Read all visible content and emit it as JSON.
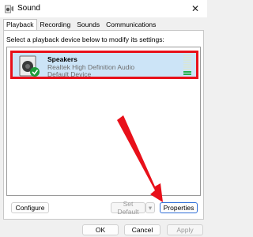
{
  "window": {
    "title": "Sound",
    "close_glyph": "✕"
  },
  "tabs": [
    {
      "label": "Playback",
      "active": true
    },
    {
      "label": "Recording",
      "active": false
    },
    {
      "label": "Sounds",
      "active": false
    },
    {
      "label": "Communications",
      "active": false
    }
  ],
  "instructions": "Select a playback device below to modify its settings:",
  "devices": [
    {
      "name": "Speakers",
      "description": "Realtek High Definition Audio",
      "status": "Default Device",
      "icon": "speaker-icon",
      "badge_icon": "default-check-icon",
      "level": 0.2
    }
  ],
  "buttons": {
    "configure": "Configure",
    "set_default": "Set Default",
    "set_default_arrow": "▾",
    "properties": "Properties",
    "ok": "OK",
    "cancel": "Cancel",
    "apply": "Apply"
  },
  "colors": {
    "highlight_border": "#e8101a",
    "arrow": "#e8101a",
    "selection_bg": "#cce4f7",
    "check_green": "#1e9b3a",
    "level_green": "#22b14c"
  }
}
